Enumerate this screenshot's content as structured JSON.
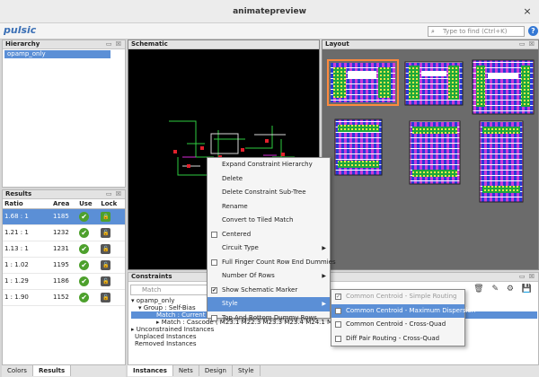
{
  "window": {
    "title": "animatepreview",
    "close": "×"
  },
  "toolbar": {
    "logo": "pulsic",
    "search_placeholder": "Type to find (Ctrl+K)",
    "help": "?"
  },
  "hierarchy": {
    "title": "Hierarchy",
    "item": "opamp_only"
  },
  "results": {
    "title": "Results",
    "columns": [
      "Ratio",
      "Area",
      "Use",
      "Lock"
    ],
    "rows": [
      {
        "ratio": "1.68 : 1",
        "area": "1185"
      },
      {
        "ratio": "1.21 : 1",
        "area": "1232"
      },
      {
        "ratio": "1.13 : 1",
        "area": "1231"
      },
      {
        "ratio": "1 : 1.02",
        "area": "1195"
      },
      {
        "ratio": "1 : 1.29",
        "area": "1186"
      },
      {
        "ratio": "1 : 1.90",
        "area": "1152"
      }
    ]
  },
  "left_tabs": [
    "Colors",
    "Results"
  ],
  "schematic": {
    "title": "Schematic"
  },
  "layout": {
    "title": "Layout"
  },
  "constraints": {
    "title": "Constraints",
    "match_placeholder": "Match",
    "tree": [
      "opamp_only",
      "Group : Self-Bias",
      "Match : Current",
      "Match : Cascode ( M23.1 M22.3 M23.3 M23.4 M24.1 M2",
      "Unconstrained Instances",
      "Unplaced Instances",
      "Removed Instances"
    ]
  },
  "bottom_tabs": [
    "Instances",
    "Nets",
    "Design",
    "Style"
  ],
  "context_menu": [
    {
      "label": "Expand Constraint Hierarchy"
    },
    {
      "label": "Delete"
    },
    {
      "label": "Delete Constraint Sub-Tree"
    },
    {
      "label": "Rename"
    },
    {
      "label": "Convert to Tiled Match"
    },
    {
      "label": "Centered"
    },
    {
      "label": "Circuit Type"
    },
    {
      "label": "Full Finger Count Row End Dummies"
    },
    {
      "label": "Number Of Rows"
    },
    {
      "label": "Show Schematic Marker"
    },
    {
      "label": "Style"
    },
    {
      "label": "Top And Bottom Dummy Rows"
    }
  ],
  "style_submenu": [
    {
      "label": "Common Centroid - Simple Routing"
    },
    {
      "label": "Common Centroid - Maximum Dispersion"
    },
    {
      "label": "Common Centroid - Cross-Quad"
    },
    {
      "label": "Diff Pair Routing - Cross-Quad"
    }
  ]
}
